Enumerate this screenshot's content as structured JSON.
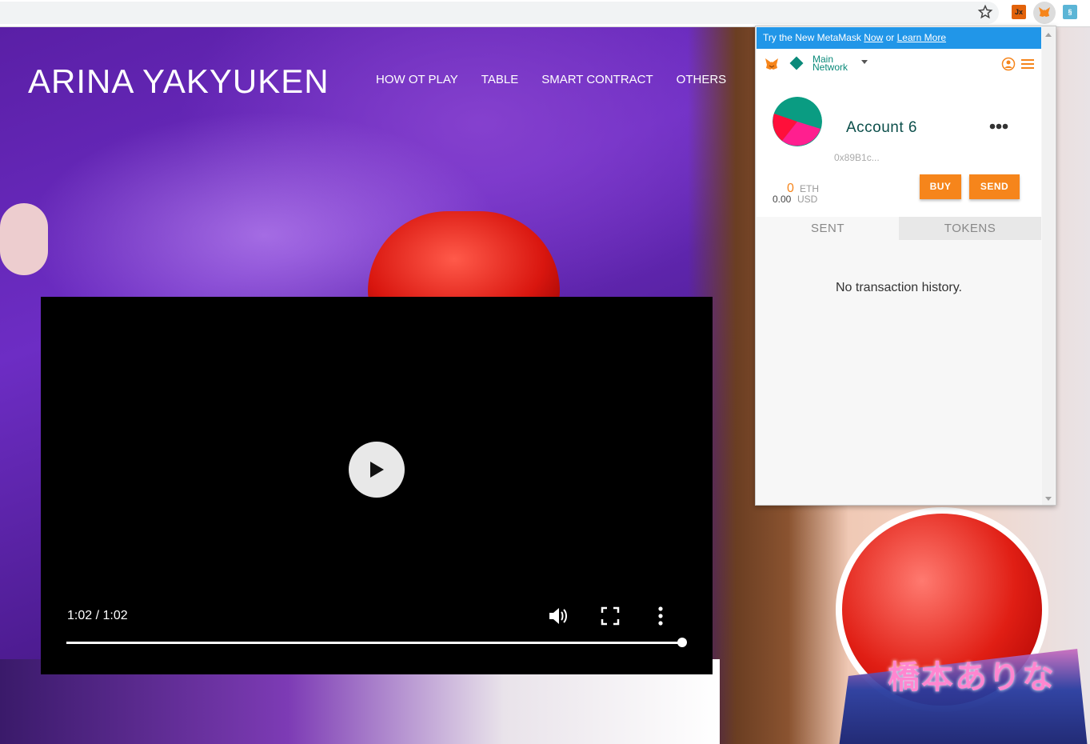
{
  "site": {
    "title": "ARINA YAKYUKEN",
    "nav": [
      "HOW OT PLAY",
      "TABLE",
      "SMART CONTRACT",
      "OTHERS"
    ],
    "logo_text": "橋本ありな"
  },
  "video": {
    "time": "1:02 / 1:02",
    "progress": 1.0
  },
  "metamask": {
    "banner_prefix": "Try the New MetaMask ",
    "banner_now": "Now",
    "banner_or": " or ",
    "banner_learn": "Learn More",
    "network_line1": "Main",
    "network_line2": "Network",
    "account_name": "Account 6",
    "address": "0x89B1c...",
    "eth_amount": "0",
    "eth_unit": "ETH",
    "usd_amount": "0.00",
    "usd_unit": "USD",
    "buy_label": "BUY",
    "send_label": "SEND",
    "tabs": [
      "SENT",
      "TOKENS"
    ],
    "empty_text": "No transaction history.",
    "colors": {
      "accent": "#f6851b",
      "banner": "#2196e8",
      "network": "#0a8a7a"
    }
  }
}
